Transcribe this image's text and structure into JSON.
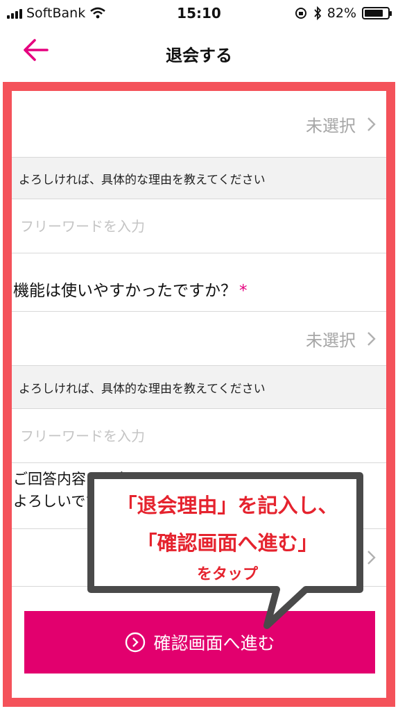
{
  "status_bar": {
    "carrier": "SoftBank",
    "time": "15:10",
    "battery": "82%",
    "battery_level": 0.82
  },
  "header": {
    "title": "退会する"
  },
  "form": {
    "select_placeholder": "未選択",
    "reason_prompt": "よろしければ、具体的な理由を教えてください",
    "free_input_placeholder": "フリーワードを入力",
    "question_usability": "機能は使いやすかったですか？",
    "required_mark": "*",
    "question_partial": "ご回答内容を入力していただけますでしょうか。も\nよろしいですか"
  },
  "confirm_button": {
    "label": "確認画面へ進む"
  },
  "callout": {
    "line1": "「退会理由」を記入し、",
    "line2": "「確認画面へ進む」",
    "line3": "をタップ"
  },
  "colors": {
    "accent": "#e2006e",
    "frame": "#f4525a",
    "callout_text": "#e5232e"
  }
}
